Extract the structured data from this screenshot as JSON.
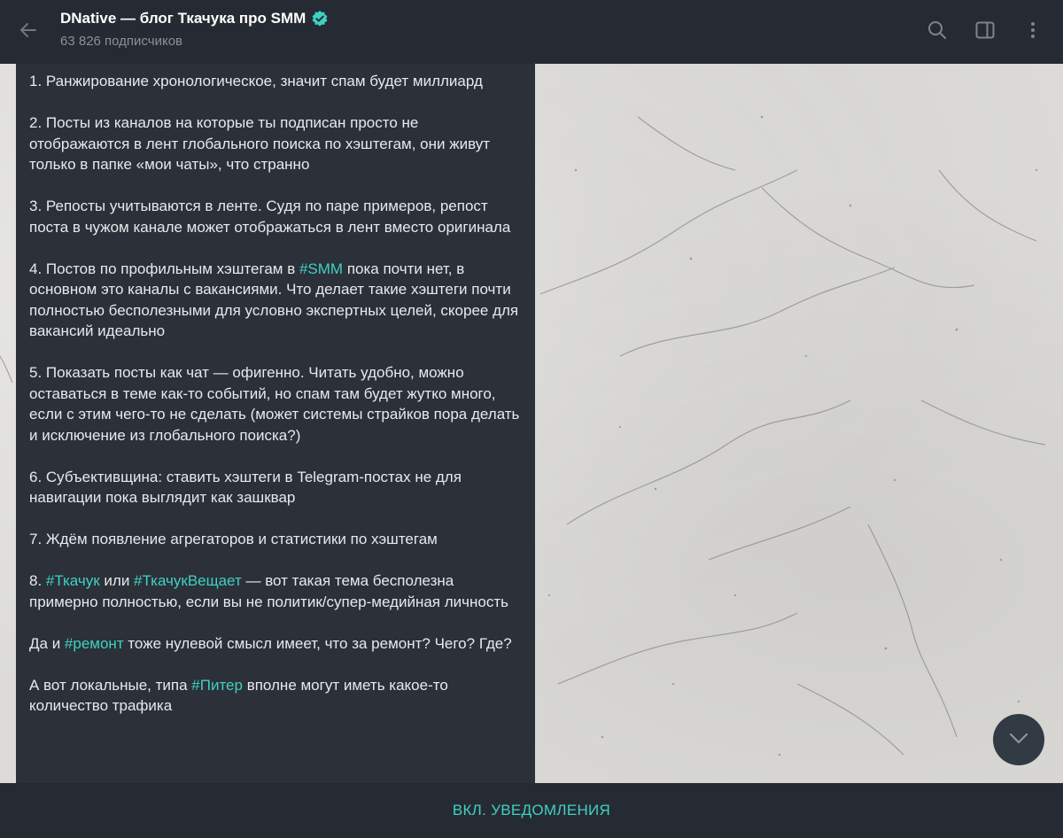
{
  "header": {
    "title": "DNative — блог Ткачука про SMM",
    "subtitle": "63 826 подписчиков",
    "verified": true,
    "icons": [
      "back-arrow-icon",
      "verified-icon",
      "search-icon",
      "sidebar-toggle-icon",
      "more-vertical-icon"
    ]
  },
  "message": {
    "p1": "1. Ранжирование хронологическое, значит спам будет миллиард",
    "p2": "2. Посты из каналов на которые ты подписан просто не отображаются в лент глобального поиска по хэштегам, они живут только в папке «мои чаты», что странно",
    "p3": "3. Репосты учитываются в ленте. Судя по паре примеров, репост поста в чужом канале может отображаться в лент вместо оригинала",
    "p4": {
      "before": "4. Постов по профильным хэштегам в ",
      "tag": "#SMM",
      "after": " пока почти нет, в основном это каналы с вакансиями. Что делает такие хэштеги почти полностью бесполезными для условно экспертных целей, скорее для вакансий идеально"
    },
    "p5": "5. Показать посты как чат — офигенно. Читать удобно, можно оставаться в теме как-то событий, но спам там будет жутко много, если с этим чего-то не сделать (может системы страйков пора делать и исключение из глобального поиска?)",
    "p6": "6. Субъективщина: ставить хэштеги в Telegram-постах не для навигации пока выглядит как зашквар",
    "p7": "7. Ждём появление агрегаторов и статистики по хэштегам",
    "p8": {
      "before": "8. ",
      "tag1": "#Ткачук",
      "mid": " или ",
      "tag2": "#ТкачукВещает",
      "after": " — вот такая тема бесполезна примерно полностью, если вы не политик/супер-медийная личность"
    },
    "p9": {
      "before": "Да и ",
      "tag": "#ремонт",
      "after": " тоже нулевой смысл имеет, что за ремонт? Чего? Где?"
    },
    "p10": {
      "before": "А вот локальные, типа ",
      "tag": "#Питер",
      "after": " вполне могут иметь какое-то количество трафика"
    }
  },
  "bottom": {
    "notify_label": "ВКЛ. УВЕДОМЛЕНИЯ"
  },
  "colors": {
    "header_bg": "#262b33",
    "bubble_bg": "#2b3039",
    "accent": "#3fd1c1",
    "verified": "#3fd1c1"
  }
}
